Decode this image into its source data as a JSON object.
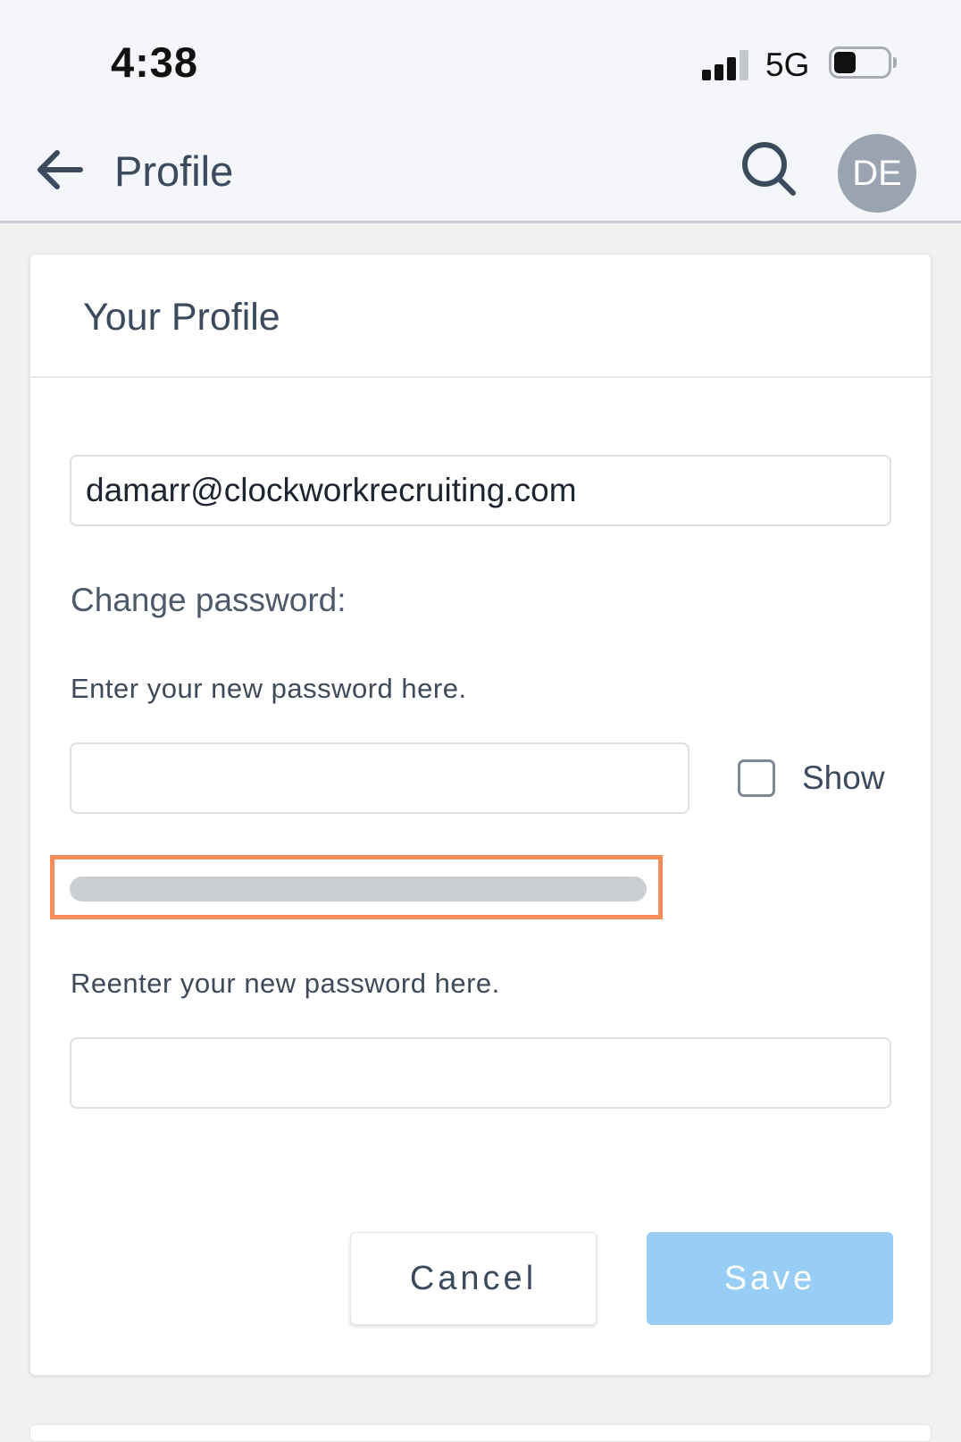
{
  "status_bar": {
    "time": "4:38",
    "network": "5G",
    "signal_bars": 3,
    "battery_level": 0.35
  },
  "header": {
    "title": "Profile",
    "back_icon": "arrow-left-icon",
    "search_icon": "search-icon",
    "avatar_initials": "DE"
  },
  "profile": {
    "card_title": "Your Profile",
    "email_value": "damarr@clockworkrecruiting.com",
    "change_password_label": "Change password:",
    "new_password_label": "Enter your new password here.",
    "new_password_value": "",
    "show_label": "Show",
    "show_checked": false,
    "strength_level": 0,
    "reenter_label": "Reenter your new password here.",
    "confirm_password_value": "",
    "cancel_label": "Cancel",
    "save_label": "Save"
  },
  "colors": {
    "accent": "#98cdf5",
    "highlight": "#f58c5a",
    "avatar_bg": "#9aa3b0"
  }
}
